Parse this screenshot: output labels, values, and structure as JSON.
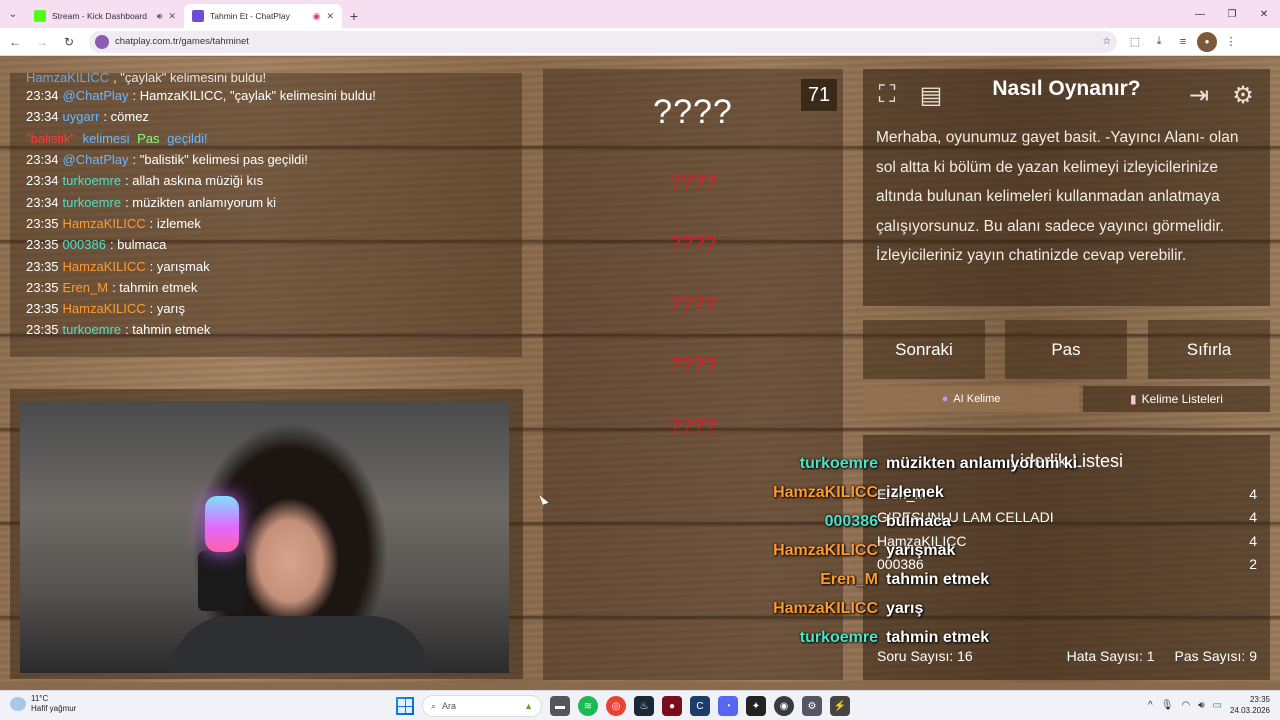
{
  "browser": {
    "tabs": [
      {
        "title": "Stream - Kick Dashboard",
        "favicon_color": "#53fc18",
        "audio_icon": "speaker-icon"
      },
      {
        "title": "Tahmin Et - ChatPlay",
        "favicon_color": "#6b4fd8",
        "audio_icon": "record-icon"
      }
    ],
    "url": "chatplay.com.tr/games/tahminet"
  },
  "chat": {
    "lines": [
      {
        "time": "",
        "user": "HamzaKILICC",
        "text": ", \"çaylak\" kelimesini buldu!",
        "user_color": "blue",
        "cut": true
      },
      {
        "time": "23:34",
        "user": "@ChatPlay",
        "text": ": HamzaKILICC, \"çaylak\" kelimesini buldu!",
        "user_color": "blue"
      },
      {
        "time": "23:34",
        "user": "uygarr",
        "text": ": cömez",
        "user_color": "blue"
      },
      {
        "time": "",
        "user": "\"balistik\"",
        "text": " kelimesi ",
        "user_color": "red",
        "extra": "Pas",
        "extra2": " geçildi!"
      },
      {
        "time": "23:34",
        "user": "@ChatPlay",
        "text": ": \"balistik\" kelimesi pas geçildi!",
        "user_color": "blue"
      },
      {
        "time": "23:34",
        "user": "turkoemre",
        "text": ": allah askına müziği kıs",
        "user_color": "teal"
      },
      {
        "time": "23:34",
        "user": "turkoemre",
        "text": ": müzikten anlamıyorum ki",
        "user_color": "teal"
      },
      {
        "time": "23:35",
        "user": "HamzaKILICC",
        "text": ": izlemek",
        "user_color": "orange"
      },
      {
        "time": "23:35",
        "user": "000386",
        "text": ": bulmaca",
        "user_color": "teal"
      },
      {
        "time": "23:35",
        "user": "HamzaKILICC",
        "text": ": yarışmak",
        "user_color": "orange"
      },
      {
        "time": "23:35",
        "user": "Eren_M",
        "text": ": tahmin etmek",
        "user_color": "orange"
      },
      {
        "time": "23:35",
        "user": "HamzaKILICC",
        "text": ": yarış",
        "user_color": "orange"
      },
      {
        "time": "23:35",
        "user": "turkoemre",
        "text": ": tahmin etmek",
        "user_color": "teal"
      }
    ]
  },
  "game": {
    "timer": "71",
    "main_word": "????",
    "taboo_words": [
      "????",
      "????",
      "????",
      "????",
      "????"
    ]
  },
  "howto": {
    "title": "Nasıl Oynanır?",
    "body": "Merhaba, oyunumuz gayet basit. -Yayıncı Alanı- olan sol altta ki bölüm de yazan kelimeyi izleyicilerinize altında bulunan kelimeleri kullanmadan anlatmaya çalışıyorsunuz. Bu alanı sadece yayıncı görmelidir. İzleyicileriniz yayın chatinizde cevap verebilir."
  },
  "controls": {
    "next": "Sonraki",
    "pass": "Pas",
    "reset": "Sıfırla",
    "ai_word": "AI Kelime",
    "word_lists": "Kelime Listeleri"
  },
  "leaderboard": {
    "title": "Liderlik Listesi",
    "rows": [
      {
        "name": "Eren_M",
        "score": "4"
      },
      {
        "name": "GIRESUNLU LAM CELLADI",
        "score": "4"
      },
      {
        "name": "HamzaKILICC",
        "score": "4"
      },
      {
        "name": "000386",
        "score": "2"
      }
    ],
    "question_count_label": "Soru Sayısı: 16",
    "error_count_label": "Hata Sayısı: 1",
    "pass_count_label": "Pas Sayısı: 9"
  },
  "overlay_chat": [
    {
      "user": "turkoemre",
      "msg": "müzikten anlamıyorum ki",
      "color": "#4fe0c8"
    },
    {
      "user": "HamzaKILICC",
      "msg": "izlemek",
      "color": "#ff9a2e"
    },
    {
      "user": "000386",
      "msg": "bulmaca",
      "color": "#4fe0c8"
    },
    {
      "user": "HamzaKILICC",
      "msg": "yarışmak",
      "color": "#ff9a2e"
    },
    {
      "user": "Eren_M",
      "msg": "tahmin etmek",
      "color": "#ff9a2e"
    },
    {
      "user": "HamzaKILICC",
      "msg": "yarış",
      "color": "#ff9a2e"
    },
    {
      "user": "turkoemre",
      "msg": "tahmin etmek",
      "color": "#4fe0c8"
    }
  ],
  "taskbar": {
    "temp": "11°C",
    "weather": "Hafif yağmur",
    "search": "Ara",
    "time": "23:35",
    "date": "24.03.2026"
  }
}
